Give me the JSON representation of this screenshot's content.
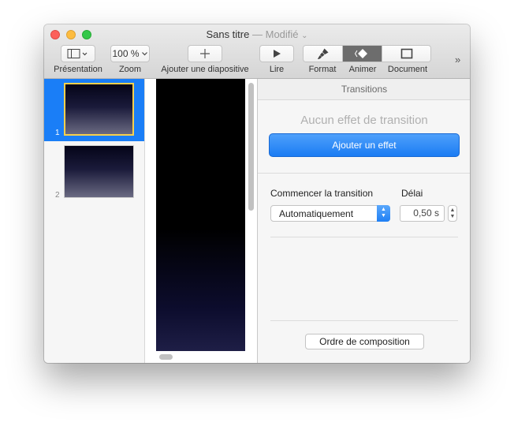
{
  "window": {
    "title": "Sans titre",
    "title_separator": "—",
    "title_status": "Modifié",
    "title_chevron": "⌄"
  },
  "toolbar": {
    "presentation_label": "Présentation",
    "zoom_value": "100 %",
    "zoom_label": "Zoom",
    "add_slide_label": "Ajouter une diapositive",
    "play_label": "Lire",
    "format_label": "Format",
    "animate_label": "Animer",
    "document_label": "Document",
    "overflow_glyph": "»",
    "active_segment": "Animer"
  },
  "navigator": {
    "slides": [
      {
        "number": "1",
        "selected": true
      },
      {
        "number": "2",
        "selected": false
      }
    ]
  },
  "inspector": {
    "header": "Transitions",
    "no_effect_text": "Aucun effet de transition",
    "add_effect_label": "Ajouter un effet",
    "start_transition_label": "Commencer la transition",
    "start_transition_value": "Automatiquement",
    "delay_label": "Délai",
    "delay_value": "0,50 s",
    "build_order_label": "Ordre de composition"
  },
  "colors": {
    "accent": "#1a7ef7",
    "selection_outline": "#f6d04d",
    "close": "#fc605b",
    "minimize": "#fdbc40",
    "maximize": "#34c84a"
  }
}
